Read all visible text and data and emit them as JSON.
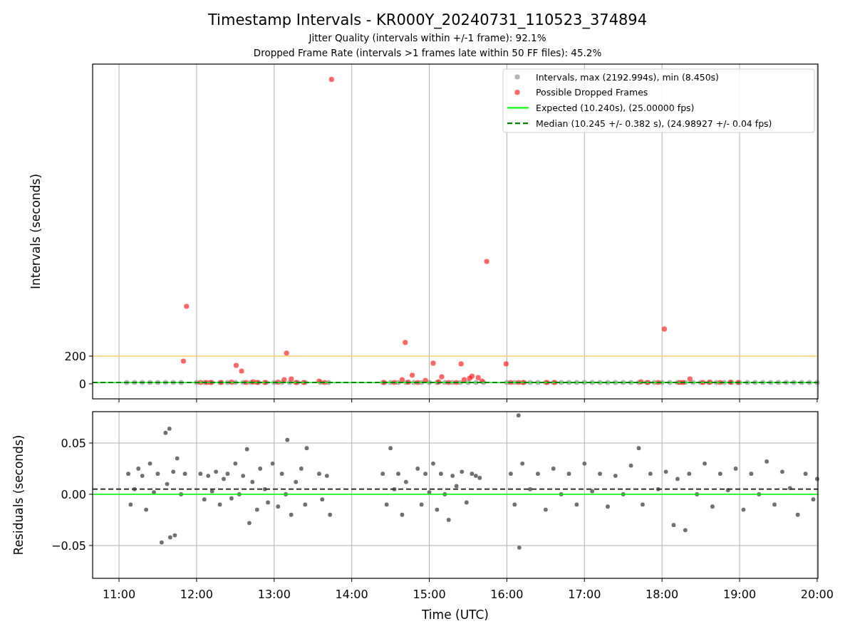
{
  "figure": {
    "title": "Timestamp Intervals - KR000Y_20240731_110523_374894",
    "subtitles": [
      "Jitter Quality (intervals within +/-1 frame): 92.1%",
      "Dropped Frame Rate (intervals >1 frames late within 50 FF files): 45.2%"
    ]
  },
  "intervals_chart": {
    "chart_data": {
      "type": "scatter",
      "ylabel": "Intervals (seconds)",
      "xlim": [
        10.66,
        20.01
      ],
      "ylim": [
        -108,
        2303
      ],
      "grid": "x",
      "yticks": [
        {
          "value": 0,
          "label": "0"
        },
        {
          "value": 200,
          "label": "200"
        }
      ],
      "legend": "upper right",
      "ref_lines": [
        {
          "axis": "y",
          "value": 200,
          "color": "#ffcc66"
        },
        {
          "axis": "y",
          "value": 10.24,
          "label": "Expected (10.240s), (25.00000 fps)",
          "color": "#00ff00"
        },
        {
          "axis": "y",
          "value": 10.245,
          "label": "Median (10.245 +/- 0.382 s), (24.98927 +/- 0.04 fps)",
          "color": "#008000"
        }
      ],
      "series": [
        {
          "name": "Intervals, max (2192.994s), min (8.450s)",
          "color": "#808080",
          "x": [
            11.1,
            11.2,
            11.3,
            11.4,
            11.5,
            11.6,
            11.7,
            11.8,
            12.0,
            12.1,
            12.2,
            12.3,
            12.4,
            12.5,
            12.6,
            12.7,
            12.8,
            12.9,
            13.0,
            13.1,
            13.2,
            13.3,
            13.4,
            13.6,
            13.7,
            14.4,
            14.5,
            14.6,
            14.7,
            14.8,
            14.9,
            15.0,
            15.1,
            15.2,
            15.3,
            15.4,
            15.5,
            15.6,
            15.7,
            16.0,
            16.1,
            16.2,
            16.3,
            16.4,
            16.5,
            16.6,
            16.7,
            16.8,
            16.9,
            17.0,
            17.1,
            17.2,
            17.3,
            17.4,
            17.5,
            17.6,
            17.7,
            17.8,
            17.9,
            18.0,
            18.1,
            18.2,
            18.3,
            18.4,
            18.5,
            18.6,
            18.7,
            18.8,
            18.9,
            19.0,
            19.1,
            19.2,
            19.3,
            19.4,
            19.5,
            19.6,
            19.7,
            19.8,
            19.9,
            20.0
          ],
          "values": [
            10,
            10,
            10,
            10,
            10,
            10,
            10,
            10,
            10,
            10,
            10,
            10,
            10,
            10,
            10,
            10,
            10,
            10,
            10,
            10,
            10,
            10,
            10,
            10,
            10,
            10,
            10,
            10,
            10,
            10,
            10,
            10,
            10,
            10,
            10,
            10,
            10,
            10,
            10,
            10,
            10,
            10,
            10,
            10,
            10,
            10,
            10,
            10,
            10,
            10,
            10,
            10,
            10,
            10,
            10,
            10,
            10,
            10,
            10,
            10,
            10,
            10,
            10,
            10,
            10,
            10,
            10,
            10,
            10,
            10,
            10,
            10,
            10,
            10,
            10,
            10,
            10,
            10,
            10,
            10
          ]
        },
        {
          "name": "Possible Dropped Frames",
          "color": "#ff0000",
          "x": [
            11.83,
            11.87,
            12.05,
            12.13,
            12.18,
            12.32,
            12.45,
            12.51,
            12.58,
            12.64,
            12.73,
            12.78,
            12.88,
            13.05,
            13.13,
            13.16,
            13.22,
            13.28,
            13.38,
            13.58,
            13.65,
            13.74,
            14.42,
            14.55,
            14.65,
            14.69,
            14.73,
            14.78,
            14.85,
            14.95,
            15.05,
            15.12,
            15.16,
            15.25,
            15.35,
            15.41,
            15.45,
            15.52,
            15.55,
            15.63,
            15.68,
            15.74,
            15.99,
            16.05,
            16.15,
            16.22,
            16.52,
            16.62,
            17.73,
            17.82,
            17.95,
            18.03,
            18.23,
            18.27,
            18.36,
            18.53,
            18.62,
            18.75,
            18.88,
            18.98
          ],
          "values": [
            164,
            559,
            10,
            10,
            10,
            10,
            12,
            133,
            92,
            10,
            14,
            10,
            10,
            12,
            30,
            221,
            35,
            10,
            10,
            20,
            10,
            2193,
            10,
            10,
            30,
            298,
            12,
            62,
            10,
            25,
            149,
            14,
            50,
            10,
            10,
            144,
            30,
            40,
            55,
            45,
            20,
            882,
            144,
            10,
            10,
            10,
            10,
            10,
            15,
            10,
            10,
            395,
            10,
            10,
            35,
            10,
            12,
            10,
            12,
            10
          ]
        }
      ]
    }
  },
  "residuals_chart": {
    "chart_data": {
      "type": "scatter",
      "xlabel": "Time (UTC)",
      "ylabel": "Residuals (seconds)",
      "xlim": [
        10.66,
        20.01
      ],
      "ylim": [
        -0.082,
        0.0806
      ],
      "grid": "both",
      "xticks": [
        {
          "value": 11,
          "label": "11:00"
        },
        {
          "value": 12,
          "label": "12:00"
        },
        {
          "value": 13,
          "label": "13:00"
        },
        {
          "value": 14,
          "label": "14:00"
        },
        {
          "value": 15,
          "label": "15:00"
        },
        {
          "value": 16,
          "label": "16:00"
        },
        {
          "value": 17,
          "label": "17:00"
        },
        {
          "value": 18,
          "label": "18:00"
        },
        {
          "value": 19,
          "label": "19:00"
        },
        {
          "value": 20,
          "label": "20:00"
        }
      ],
      "yticks": [
        {
          "value": -0.05,
          "label": "−0.05"
        },
        {
          "value": 0,
          "label": "0.00"
        },
        {
          "value": 0.05,
          "label": "0.05"
        }
      ],
      "ref_lines": [
        {
          "axis": "y",
          "value": 0,
          "color": "#00ff00"
        },
        {
          "axis": "y",
          "value": 0.005,
          "color": "#333333"
        }
      ],
      "series": [
        {
          "color": "#707070",
          "x": [
            11.12,
            11.15,
            11.2,
            11.25,
            11.3,
            11.35,
            11.4,
            11.45,
            11.5,
            11.55,
            11.6,
            11.62,
            11.65,
            11.66,
            11.7,
            11.72,
            11.75,
            11.8,
            11.85,
            12.05,
            12.1,
            12.15,
            12.2,
            12.25,
            12.3,
            12.35,
            12.4,
            12.45,
            12.5,
            12.55,
            12.6,
            12.65,
            12.68,
            12.72,
            12.78,
            12.82,
            12.88,
            12.92,
            12.98,
            13.05,
            13.1,
            13.15,
            13.17,
            13.22,
            13.28,
            13.35,
            13.4,
            13.42,
            13.58,
            13.62,
            13.68,
            13.72,
            14.4,
            14.45,
            14.5,
            14.55,
            14.6,
            14.65,
            14.7,
            14.85,
            14.9,
            14.95,
            15.0,
            15.05,
            15.1,
            15.15,
            15.2,
            15.25,
            15.3,
            15.35,
            15.42,
            15.48,
            15.55,
            15.6,
            15.65,
            16.05,
            16.1,
            16.15,
            16.16,
            16.2,
            16.3,
            16.4,
            16.5,
            16.6,
            16.7,
            16.8,
            16.9,
            17.0,
            17.1,
            17.2,
            17.3,
            17.4,
            17.5,
            17.6,
            17.7,
            17.75,
            17.85,
            17.95,
            18.05,
            18.15,
            18.2,
            18.3,
            18.35,
            18.45,
            18.55,
            18.65,
            18.75,
            18.85,
            18.95,
            19.05,
            19.15,
            19.25,
            19.35,
            19.45,
            19.55,
            19.65,
            19.75,
            19.85,
            19.95,
            20.0
          ],
          "values": [
            0.02,
            -0.01,
            0.005,
            0.025,
            0.018,
            -0.015,
            0.03,
            0.002,
            0.02,
            -0.047,
            0.06,
            0.01,
            0.064,
            -0.042,
            0.022,
            -0.04,
            0.035,
            0.0,
            0.02,
            0.02,
            -0.005,
            0.018,
            0.003,
            0.022,
            -0.01,
            0.015,
            0.02,
            -0.004,
            0.03,
            0.0,
            0.018,
            0.044,
            -0.028,
            0.012,
            -0.015,
            0.025,
            0.005,
            -0.008,
            0.03,
            -0.012,
            0.02,
            0.0,
            0.053,
            -0.02,
            0.012,
            0.025,
            -0.01,
            0.045,
            0.02,
            -0.005,
            0.018,
            -0.02,
            0.02,
            -0.01,
            0.045,
            0.005,
            0.02,
            -0.02,
            0.012,
            0.025,
            -0.01,
            0.02,
            0.002,
            0.03,
            -0.015,
            0.02,
            0.0,
            -0.025,
            0.018,
            0.008,
            0.022,
            -0.008,
            0.02,
            0.018,
            0.016,
            0.02,
            -0.01,
            0.077,
            -0.052,
            0.03,
            0.005,
            0.02,
            -0.015,
            0.025,
            0.0,
            0.02,
            -0.01,
            0.03,
            0.003,
            0.02,
            -0.012,
            0.018,
            0.0,
            0.028,
            0.045,
            -0.01,
            0.02,
            0.005,
            0.022,
            -0.03,
            0.015,
            -0.035,
            0.02,
            0.0,
            0.03,
            -0.012,
            0.02,
            0.004,
            0.025,
            -0.015,
            0.02,
            0.0,
            0.032,
            -0.01,
            0.022,
            0.006,
            -0.02,
            0.02,
            -0.005,
            0.015
          ]
        }
      ]
    }
  }
}
